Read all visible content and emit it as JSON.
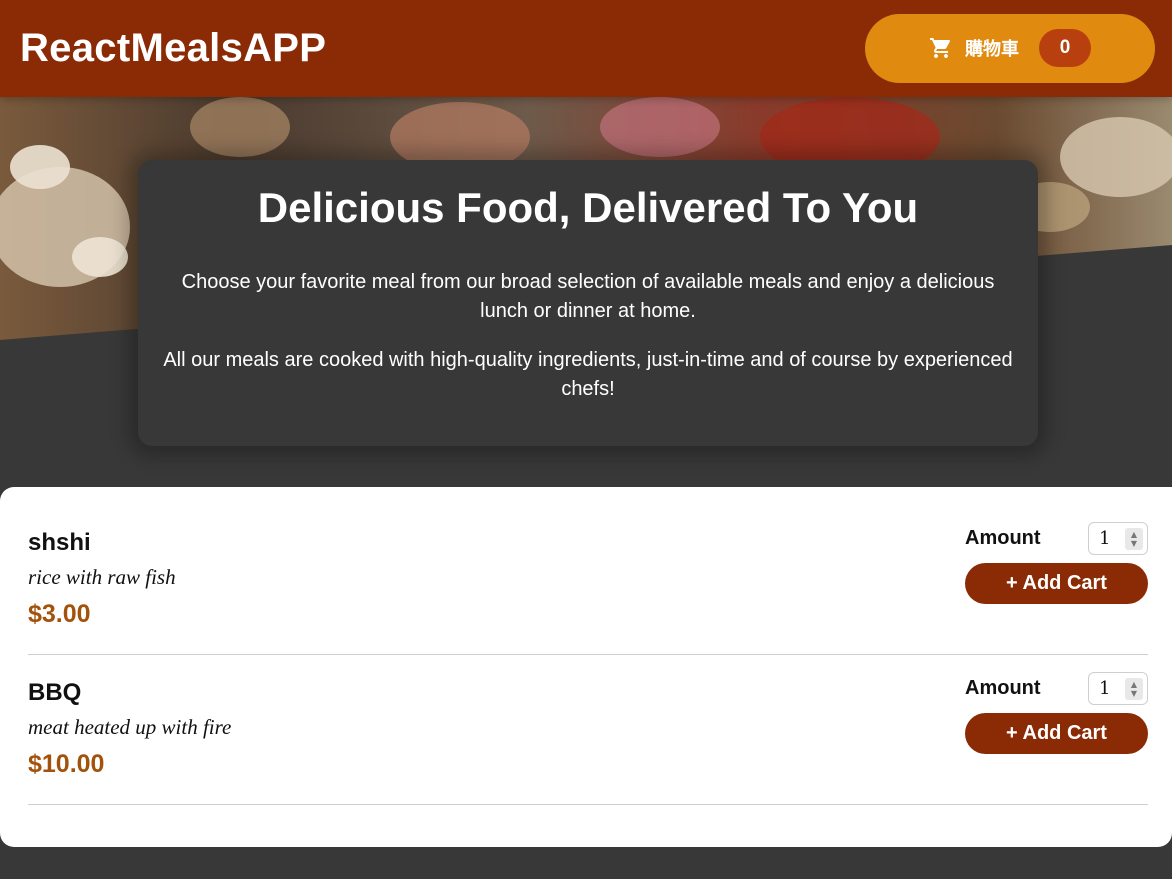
{
  "header": {
    "brand": "ReactMealsAPP",
    "cart": {
      "label": "購物車",
      "count": "0",
      "icon": "cart-icon"
    }
  },
  "summary": {
    "title": "Delicious Food, Delivered To You",
    "paragraphs": [
      "Choose your favorite meal from our broad selection of available meals and enjoy a delicious lunch or dinner at home.",
      "All our meals are cooked with high-quality ingredients, just-in-time and of course by experienced chefs!"
    ]
  },
  "meals": [
    {
      "name": "shshi",
      "description": "rice with raw fish",
      "price": "$3.00",
      "amount_label": "Amount",
      "amount_value": "1",
      "button_label": "+ Add Cart"
    },
    {
      "name": "BBQ",
      "description": "meat heated up with fire",
      "price": "$10.00",
      "amount_label": "Amount",
      "amount_value": "1",
      "button_label": "+ Add Cart"
    }
  ],
  "colors": {
    "header_bg": "#8a2b06",
    "cart_button": "#e08a10",
    "cart_badge": "#b8400e",
    "page_bg": "#383838",
    "price": "#a3520b",
    "add_button": "#8a2b06"
  }
}
